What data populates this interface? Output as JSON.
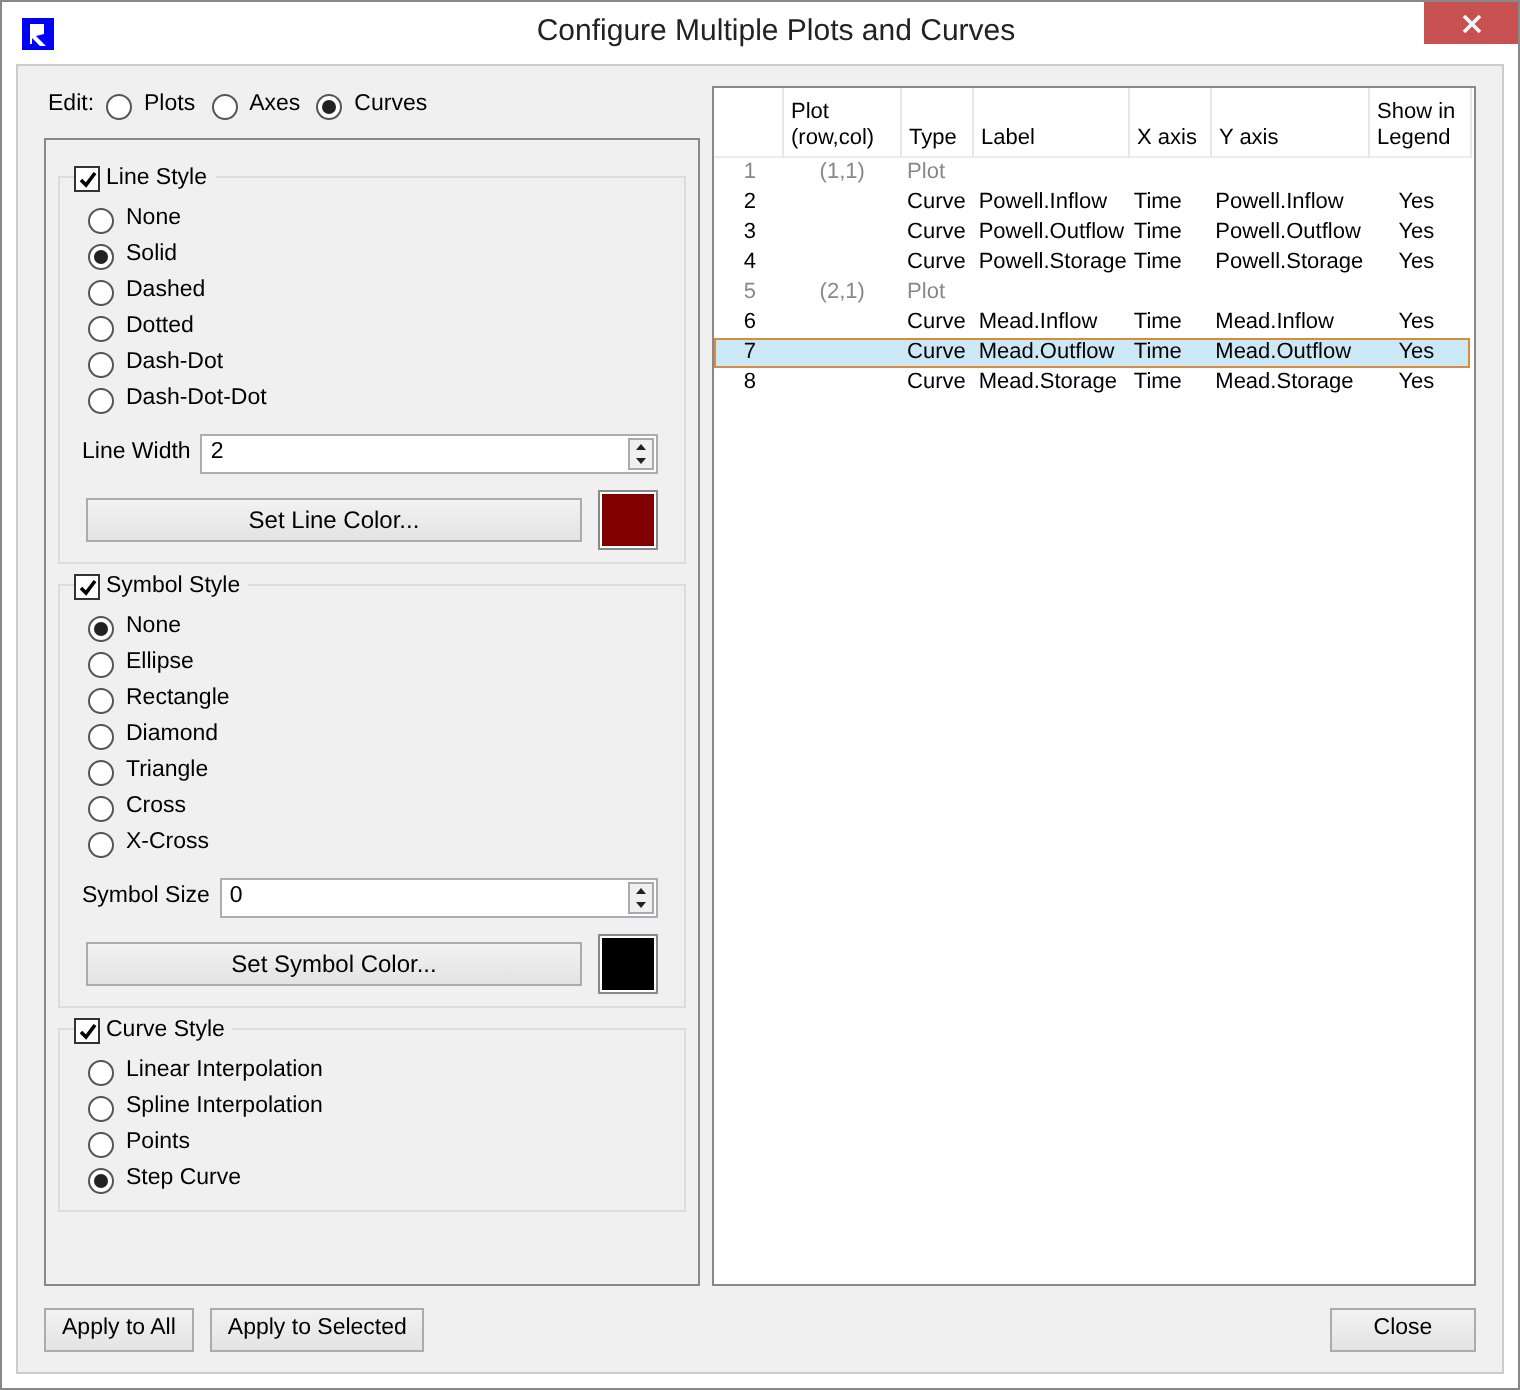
{
  "window": {
    "title": "Configure Multiple Plots and Curves"
  },
  "edit": {
    "label": "Edit:",
    "options": [
      {
        "label": "Plots",
        "selected": false
      },
      {
        "label": "Axes",
        "selected": false
      },
      {
        "label": "Curves",
        "selected": true
      }
    ]
  },
  "groups": [
    {
      "title": "Line Style",
      "checked": true,
      "options": [
        {
          "label": "None",
          "selected": false
        },
        {
          "label": "Solid",
          "selected": true
        },
        {
          "label": "Dashed",
          "selected": false
        },
        {
          "label": "Dotted",
          "selected": false
        },
        {
          "label": "Dash-Dot",
          "selected": false
        },
        {
          "label": "Dash-Dot-Dot",
          "selected": false
        }
      ],
      "spin": {
        "label": "Line Width",
        "value": "2"
      },
      "color_button": {
        "label": "Set Line Color...",
        "color": "#800000"
      }
    },
    {
      "title": "Symbol Style",
      "checked": true,
      "options": [
        {
          "label": "None",
          "selected": true
        },
        {
          "label": "Ellipse",
          "selected": false
        },
        {
          "label": "Rectangle",
          "selected": false
        },
        {
          "label": "Diamond",
          "selected": false
        },
        {
          "label": "Triangle",
          "selected": false
        },
        {
          "label": "Cross",
          "selected": false
        },
        {
          "label": "X-Cross",
          "selected": false
        }
      ],
      "spin": {
        "label": "Symbol Size",
        "value": "0"
      },
      "color_button": {
        "label": "Set Symbol Color...",
        "color": "#000000"
      }
    },
    {
      "title": "Curve Style",
      "checked": true,
      "options": [
        {
          "label": "Linear Interpolation",
          "selected": false
        },
        {
          "label": "Spline Interpolation",
          "selected": false
        },
        {
          "label": "Points",
          "selected": false
        },
        {
          "label": "Step Curve",
          "selected": true
        }
      ]
    }
  ],
  "table": {
    "columns": [
      {
        "label": "Plot\n(row,col)"
      },
      {
        "label": "Type"
      },
      {
        "label": "Label"
      },
      {
        "label": "X axis"
      },
      {
        "label": "Y axis"
      },
      {
        "label": "Show in\nLegend"
      }
    ],
    "rows": [
      {
        "index": "1",
        "kind": "plot",
        "position": "(1,1)",
        "type": "Plot",
        "selected": false
      },
      {
        "index": "2",
        "kind": "curve",
        "type": "Curve",
        "label": "Powell.Inflow",
        "x_axis": "Time",
        "y_axis": "Powell.Inflow",
        "legend": "Yes",
        "selected": false
      },
      {
        "index": "3",
        "kind": "curve",
        "type": "Curve",
        "label": "Powell.Outflow",
        "x_axis": "Time",
        "y_axis": "Powell.Outflow",
        "legend": "Yes",
        "selected": false
      },
      {
        "index": "4",
        "kind": "curve",
        "type": "Curve",
        "label": "Powell.Storage",
        "x_axis": "Time",
        "y_axis": "Powell.Storage",
        "legend": "Yes",
        "selected": false
      },
      {
        "index": "5",
        "kind": "plot",
        "position": "(2,1)",
        "type": "Plot",
        "selected": false
      },
      {
        "index": "6",
        "kind": "curve",
        "type": "Curve",
        "label": "Mead.Inflow",
        "x_axis": "Time",
        "y_axis": "Mead.Inflow",
        "legend": "Yes",
        "selected": false
      },
      {
        "index": "7",
        "kind": "curve",
        "type": "Curve",
        "label": "Mead.Outflow",
        "x_axis": "Time",
        "y_axis": "Mead.Outflow",
        "legend": "Yes",
        "selected": true
      },
      {
        "index": "8",
        "kind": "curve",
        "type": "Curve",
        "label": "Mead.Storage",
        "x_axis": "Time",
        "y_axis": "Mead.Storage",
        "legend": "Yes",
        "selected": false
      }
    ]
  },
  "buttons": {
    "left": [
      "Apply to All",
      "Apply to Selected"
    ],
    "right": [
      "Close"
    ]
  }
}
